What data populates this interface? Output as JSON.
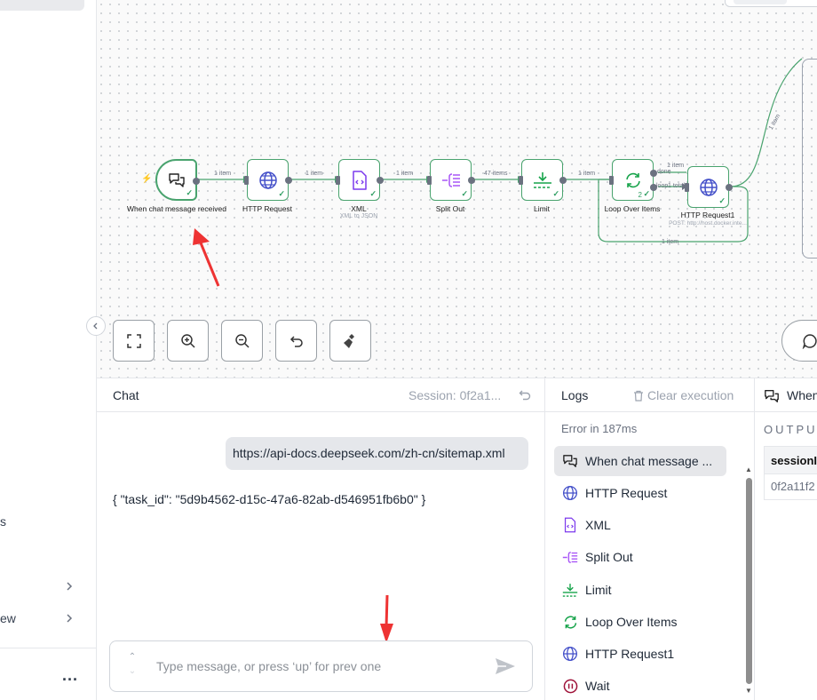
{
  "colors": {
    "node_border": "#49a36e",
    "success": "#2f9e62",
    "annotation_arrow": "#ee3333",
    "trigger_bolt": "#f97373"
  },
  "sidebar": {
    "partial_items": [
      {
        "label": "s",
        "has_chevron": false
      },
      {
        "label": "",
        "has_chevron": true
      },
      {
        "label": "ew",
        "has_chevron": true
      }
    ],
    "more_label": "..."
  },
  "canvas": {
    "nodes": [
      {
        "id": "chat-trigger",
        "name": "When chat message received",
        "icon": "chat-bubbles-icon",
        "subtitle": ""
      },
      {
        "id": "http-request",
        "name": "HTTP Request",
        "icon": "globe-icon",
        "subtitle": ""
      },
      {
        "id": "xml",
        "name": "XML",
        "icon": "file-code-icon",
        "subtitle": "XML to JSON"
      },
      {
        "id": "split-out",
        "name": "Split Out",
        "icon": "split-out-icon",
        "subtitle": ""
      },
      {
        "id": "limit",
        "name": "Limit",
        "icon": "limit-icon",
        "subtitle": ""
      },
      {
        "id": "loop-over-items",
        "name": "Loop Over Items",
        "icon": "loop-icon",
        "subtitle": "",
        "badge": "2"
      },
      {
        "id": "http-request1",
        "name": "HTTP Request1",
        "icon": "globe-icon",
        "subtitle": "POST: http://host.docker.inte..."
      }
    ],
    "edge_labels": {
      "e1": "1 item",
      "e2": "1 item",
      "e3": "1 item",
      "e4": "47 items",
      "e5": "1 item",
      "done_count": "1 item",
      "done": "done",
      "loop": "loop",
      "loop_total": "1 total",
      "loop_back": "1 item",
      "to_right": "1 item"
    },
    "controls": [
      "fit-view",
      "zoom-in",
      "zoom-out",
      "reset-zoom",
      "tidy-up"
    ]
  },
  "chat": {
    "title": "Chat",
    "session": "Session: 0f2a1...",
    "messages": [
      {
        "role": "user",
        "text": "https://api-docs.deepseek.com/zh-cn/sitemap.xml"
      },
      {
        "role": "bot",
        "text": "{ \"task_id\": \"5d9b4562-d15c-47a6-82ab-d546951fb6b0\" }"
      }
    ],
    "input": {
      "value": "",
      "placeholder": "Type message, or press ‘up’ for prev one"
    }
  },
  "logs": {
    "title": "Logs",
    "clear_label": "Clear execution",
    "status": "Error in 187ms",
    "items": [
      {
        "label": "When chat message ...",
        "icon": "chat-bubbles-icon",
        "active": true
      },
      {
        "label": "HTTP Request",
        "icon": "globe-icon",
        "active": false
      },
      {
        "label": "XML",
        "icon": "file-code-icon",
        "active": false
      },
      {
        "label": "Split Out",
        "icon": "split-out-icon",
        "active": false
      },
      {
        "label": "Limit",
        "icon": "limit-icon",
        "active": false
      },
      {
        "label": "Loop Over Items",
        "icon": "loop-icon",
        "active": false
      },
      {
        "label": "HTTP Request1",
        "icon": "globe-icon",
        "active": false
      },
      {
        "label": "Wait",
        "icon": "pause-icon",
        "active": false
      }
    ]
  },
  "detail": {
    "title": "When",
    "output_label": "OUTPUT",
    "table": {
      "header": "sessionI",
      "cell": "0f2a11f2"
    }
  }
}
